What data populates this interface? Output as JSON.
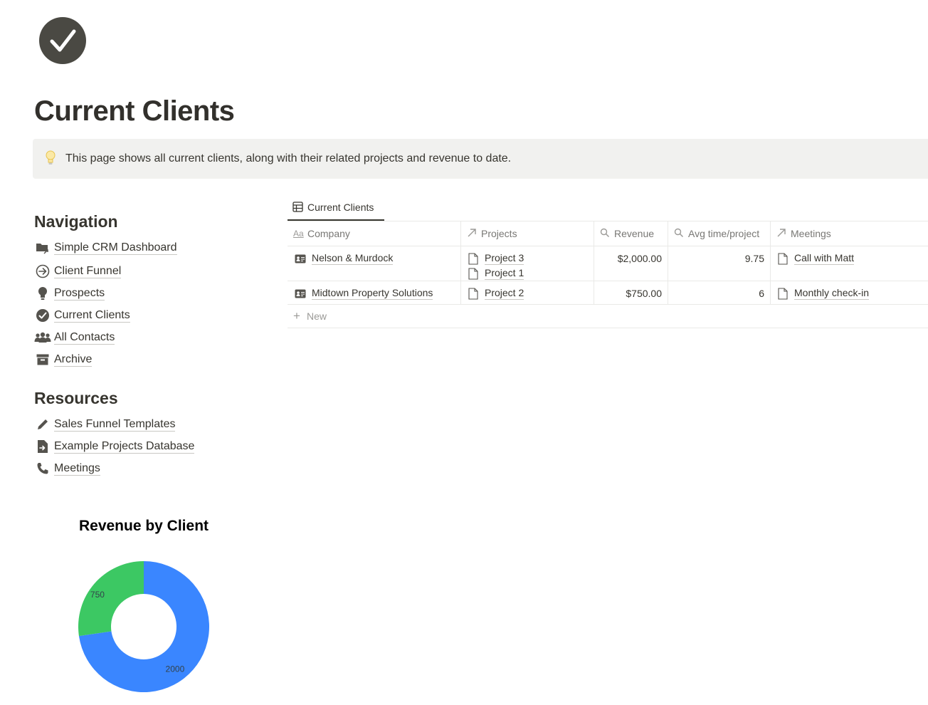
{
  "page": {
    "icon": "check-circle-icon",
    "title": "Current Clients"
  },
  "callout": {
    "icon": "lightbulb-icon",
    "text": "This page shows all current clients, along with their related projects and revenue to date."
  },
  "navigation": {
    "title": "Navigation",
    "items": [
      {
        "label": "Simple CRM Dashboard",
        "icon": "folder-arrow-icon"
      },
      {
        "label": "Client Funnel",
        "icon": "arrow-circle-icon"
      },
      {
        "label": "Prospects",
        "icon": "lightbulb-icon"
      },
      {
        "label": "Current Clients",
        "icon": "check-circle-icon"
      },
      {
        "label": "All Contacts",
        "icon": "people-icon"
      },
      {
        "label": "Archive",
        "icon": "archive-box-icon"
      }
    ]
  },
  "resources": {
    "title": "Resources",
    "items": [
      {
        "label": "Sales Funnel Templates",
        "icon": "pencil-icon"
      },
      {
        "label": "Example Projects Database",
        "icon": "file-import-icon"
      },
      {
        "label": "Meetings",
        "icon": "phone-icon"
      }
    ]
  },
  "database": {
    "view_tab": "Current Clients",
    "columns": [
      {
        "label": "Company",
        "icon": "title-aa-icon"
      },
      {
        "label": "Projects",
        "icon": "relation-arrow-icon"
      },
      {
        "label": "Revenue",
        "icon": "rollup-search-icon"
      },
      {
        "label": "Avg time/project",
        "icon": "rollup-search-icon"
      },
      {
        "label": "Meetings",
        "icon": "relation-arrow-icon"
      }
    ],
    "rows": [
      {
        "company": "Nelson & Murdock",
        "projects": [
          "Project 3",
          "Project 1"
        ],
        "revenue": "$2,000.00",
        "avg_time": "9.75",
        "meetings": [
          "Call with Matt"
        ]
      },
      {
        "company": "Midtown Property Solutions",
        "projects": [
          "Project 2"
        ],
        "revenue": "$750.00",
        "avg_time": "6",
        "meetings": [
          "Monthly check-in"
        ]
      }
    ],
    "new_label": "New"
  },
  "chart_data": {
    "type": "pie",
    "title": "Revenue by Client",
    "slices": [
      {
        "value": 2000,
        "label": "2000",
        "color": "#3a86ff"
      },
      {
        "value": 750,
        "label": "750",
        "color": "#3cc863"
      }
    ],
    "donut": true
  }
}
